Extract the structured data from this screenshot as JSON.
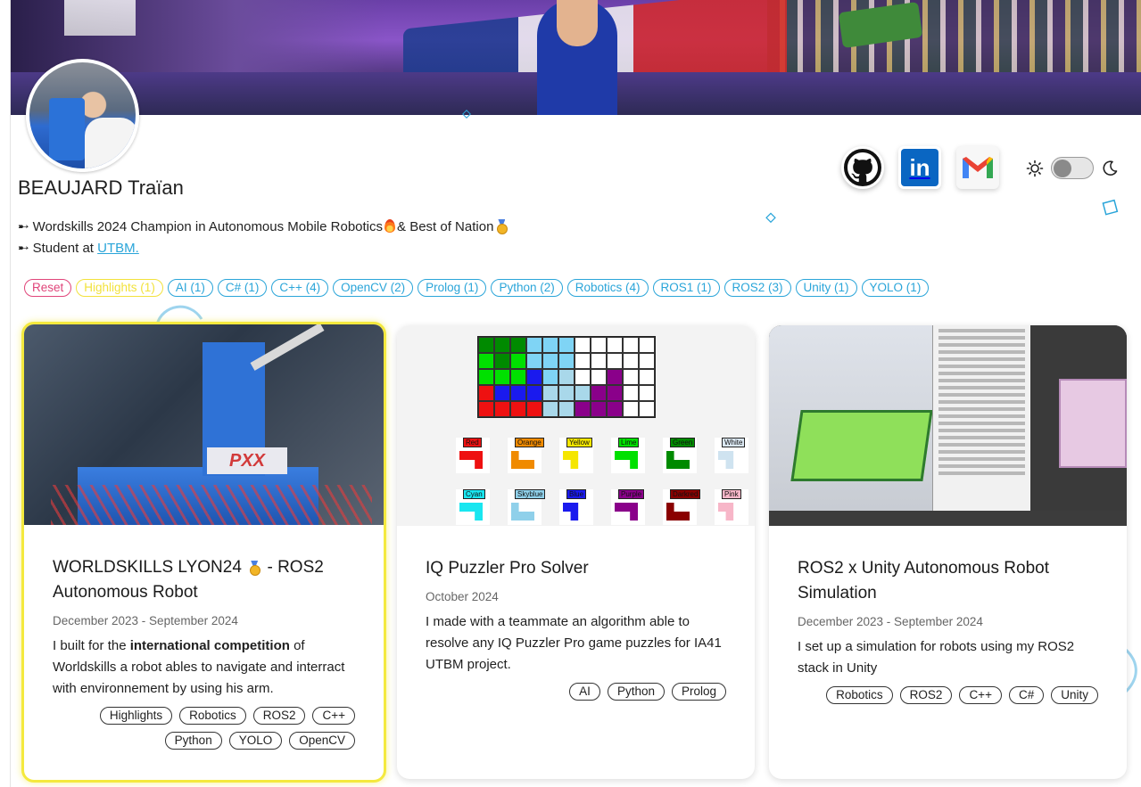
{
  "profile": {
    "name": "BEAUJARD Traïan",
    "bio_line1_a": "Wordskills 2024 Champion in Autonomous Mobile Robotics",
    "bio_line1_b": "& Best of Nation",
    "bio_line2_prefix": "Student at",
    "bio_line2_link": "UTBM.",
    "bullet": "➸"
  },
  "social": {
    "github_icon": "github-icon",
    "linkedin_icon": "linkedin-icon",
    "linkedin_text": "in",
    "gmail_icon": "gmail-icon"
  },
  "theme": {
    "sun_icon": "sun-icon",
    "moon_icon": "moon-icon",
    "dark_mode": false
  },
  "filters": [
    "Reset",
    "Highlights (1)",
    "AI (1)",
    "C# (1)",
    "C++ (4)",
    "OpenCV (2)",
    "Prolog (1)",
    "Python (2)",
    "Robotics (4)",
    "ROS1 (1)",
    "ROS2 (3)",
    "Unity (1)",
    "YOLO (1)"
  ],
  "colors": {
    "accent": "#2aa5d9",
    "reset": "#e0457a",
    "highlight": "#f4e93e"
  },
  "projects": [
    {
      "title_a": "WORLDSKILLS LYON24",
      "title_b": "- ROS2 Autonomous Robot",
      "date": "December 2023 - September 2024",
      "desc_a": "I built for the",
      "desc_bold": "international competition",
      "desc_b": "of Worldskills a robot ables to navigate and interract with environnement by using his arm.",
      "thumb_label": "PXX",
      "tags": [
        "Highlights",
        "Robotics",
        "ROS2",
        "C++",
        "Python",
        "YOLO",
        "OpenCV"
      ]
    },
    {
      "title": "IQ Puzzler Pro Solver",
      "date": "October 2024",
      "desc": "I made with a teammate an algorithm able to resolve any IQ Puzzler Pro game puzzles for IA41 UTBM project.",
      "pieces": [
        "Red",
        "Orange",
        "Yellow",
        "Lime",
        "Green",
        "White",
        "Cyan",
        "Skyblue",
        "Blue",
        "Purple",
        "Darkred",
        "Pink"
      ],
      "tags": [
        "AI",
        "Python",
        "Prolog"
      ]
    },
    {
      "title": "ROS2 x Unity Autonomous Robot Simulation",
      "date": "December 2023 - September 2024",
      "desc": "I set up a simulation for robots using my ROS2 stack in Unity",
      "tags": [
        "Robotics",
        "ROS2",
        "C++",
        "C#",
        "Unity"
      ]
    }
  ]
}
